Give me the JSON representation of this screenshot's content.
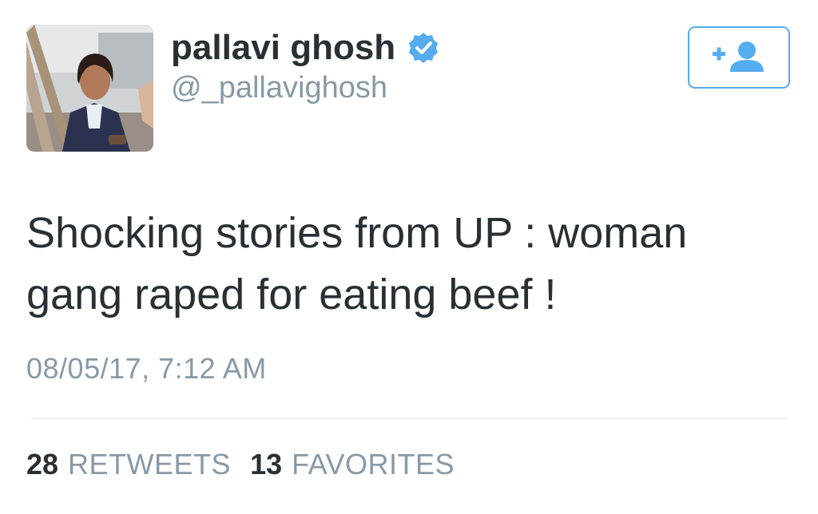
{
  "tweet": {
    "author": {
      "display_name": "pallavi ghosh",
      "handle": "@_pallavighosh",
      "verified": true,
      "avatar": "profile-photo"
    },
    "text_lines": [
      "Shocking stories from UP : woman",
      "gang raped for eating beef !"
    ],
    "timestamp": "08/05/17, 7:12 AM",
    "stats": {
      "retweets_count": "28",
      "retweets_label": "RETWEETS",
      "favorites_count": "13",
      "favorites_label": "FAVORITES"
    }
  },
  "follow_button": {
    "icon": "follow-user-icon"
  },
  "colors": {
    "accent": "#55acee",
    "text": "#292f33",
    "muted": "#8899a6",
    "divider": "#e1e8ed"
  }
}
